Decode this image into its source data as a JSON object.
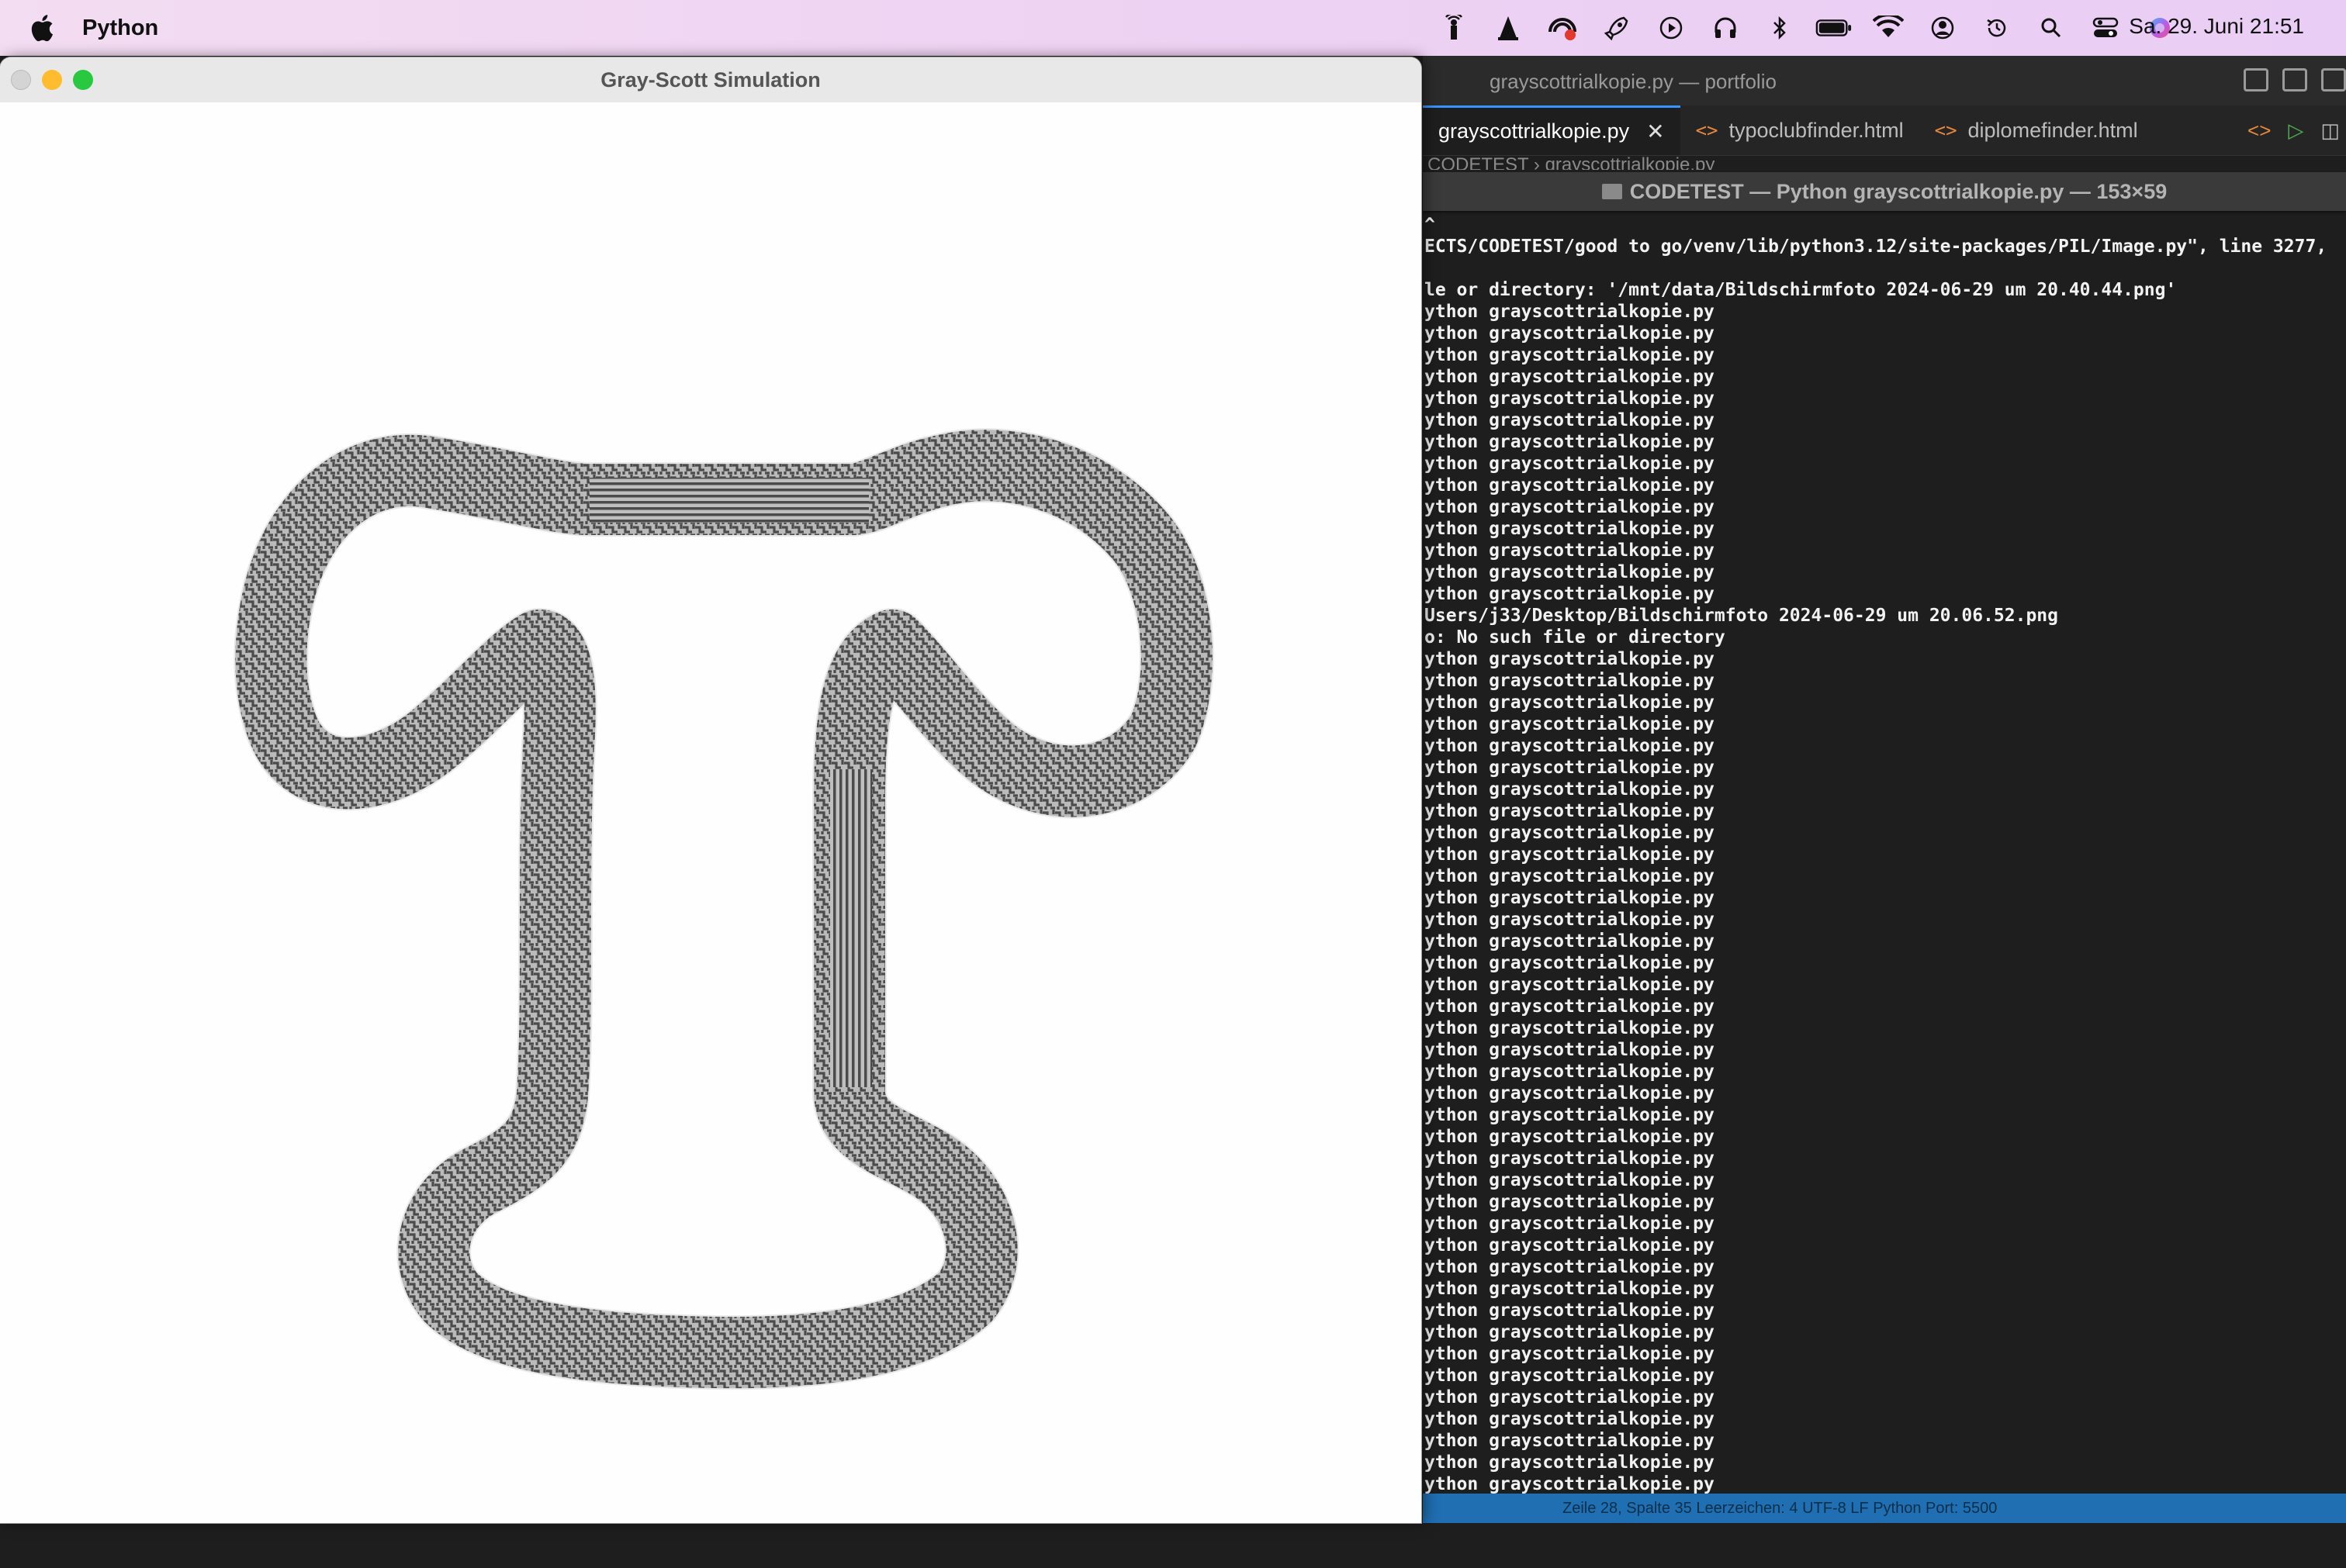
{
  "menubar": {
    "app_name": "Python",
    "clock": "Sa. 29. Juni  21:51",
    "status_icons": [
      "broadcast-icon",
      "cone-icon",
      "network-icon",
      "rocket-icon",
      "play-icon",
      "headphones-icon",
      "bluetooth-icon",
      "battery-icon",
      "wifi-icon",
      "user-icon",
      "time-machine-icon",
      "search-icon",
      "control-center-icon",
      "siri-icon"
    ]
  },
  "sim": {
    "title": "Gray-Scott Simulation"
  },
  "editor": {
    "title": "grayscottrialkopie.py — portfolio",
    "tabs": [
      {
        "label": "grayscottrialkopie.py",
        "active": true
      },
      {
        "label": "typoclubfinder.html",
        "active": false
      },
      {
        "label": "diplomefinder.html",
        "active": false
      }
    ],
    "breadcrumb": "CODETEST  ›  grayscottrialkopie.py"
  },
  "terminal": {
    "title": "CODETEST — Python grayscottrialkopie.py — 153×59",
    "lines": [
      "^",
      "ECTS/CODETEST/good to go/venv/lib/python3.12/site-packages/PIL/Image.py\", line 3277,",
      "",
      "le or directory: '/mnt/data/Bildschirmfoto 2024-06-29 um 20.40.44.png'",
      "ython grayscottrialkopie.py",
      "ython grayscottrialkopie.py",
      "ython grayscottrialkopie.py",
      "ython grayscottrialkopie.py",
      "ython grayscottrialkopie.py",
      "ython grayscottrialkopie.py",
      "ython grayscottrialkopie.py",
      "ython grayscottrialkopie.py",
      "ython grayscottrialkopie.py",
      "ython grayscottrialkopie.py",
      "ython grayscottrialkopie.py",
      "ython grayscottrialkopie.py",
      "ython grayscottrialkopie.py",
      "ython grayscottrialkopie.py",
      "Users/j33/Desktop/Bildschirmfoto 2024-06-29 um 20.06.52.png",
      "o: No such file or directory",
      "ython grayscottrialkopie.py",
      "ython grayscottrialkopie.py",
      "ython grayscottrialkopie.py",
      "ython grayscottrialkopie.py",
      "ython grayscottrialkopie.py",
      "ython grayscottrialkopie.py",
      "ython grayscottrialkopie.py",
      "ython grayscottrialkopie.py",
      "ython grayscottrialkopie.py",
      "ython grayscottrialkopie.py",
      "ython grayscottrialkopie.py",
      "ython grayscottrialkopie.py",
      "ython grayscottrialkopie.py",
      "ython grayscottrialkopie.py",
      "ython grayscottrialkopie.py",
      "ython grayscottrialkopie.py",
      "ython grayscottrialkopie.py",
      "ython grayscottrialkopie.py",
      "ython grayscottrialkopie.py",
      "ython grayscottrialkopie.py",
      "ython grayscottrialkopie.py",
      "ython grayscottrialkopie.py",
      "ython grayscottrialkopie.py",
      "ython grayscottrialkopie.py",
      "ython grayscottrialkopie.py",
      "ython grayscottrialkopie.py",
      "ython grayscottrialkopie.py",
      "ython grayscottrialkopie.py",
      "ython grayscottrialkopie.py",
      "ython grayscottrialkopie.py",
      "ython grayscottrialkopie.py",
      "ython grayscottrialkopie.py",
      "ython grayscottrialkopie.py",
      "ython grayscottrialkopie.py",
      "ython grayscottrialkopie.py",
      "ython grayscottrialkopie.py",
      "ython grayscottrialkopie.py",
      "ython grayscottrialkopie.py",
      "ython grayscottrialkopie.py"
    ]
  },
  "statusbar": {
    "text": "Zeile 28, Spalte 35   Leerzeichen: 4   UTF-8   LF   Python   Port: 5500"
  },
  "colors": {
    "accent": "#3794ff",
    "html_icon": "#e8883a",
    "pattern_dark": "#4a4a4a",
    "pattern_light": "#c8c8c8"
  }
}
